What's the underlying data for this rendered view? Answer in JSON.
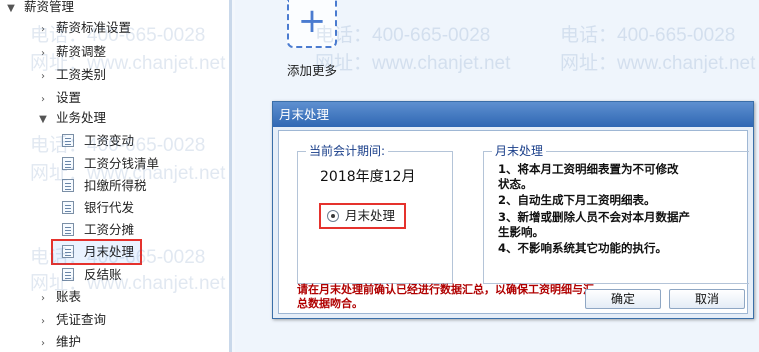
{
  "sidebar": {
    "items": [
      {
        "label": "薪资管理",
        "arrow": "▼"
      },
      {
        "label": "薪资标准设置",
        "arrow": "›"
      },
      {
        "label": "薪资调整",
        "arrow": "›"
      },
      {
        "label": "工资类别",
        "arrow": "›"
      },
      {
        "label": "设置",
        "arrow": "›"
      },
      {
        "label": "业务处理",
        "arrow": "▼"
      },
      {
        "label": "工资变动"
      },
      {
        "label": "工资分钱清单"
      },
      {
        "label": "扣缴所得税"
      },
      {
        "label": "银行代发"
      },
      {
        "label": "工资分摊"
      },
      {
        "label": "月末处理"
      },
      {
        "label": "反结账"
      },
      {
        "label": "账表",
        "arrow": "›"
      },
      {
        "label": "凭证查询",
        "arrow": "›"
      },
      {
        "label": "维护",
        "arrow": "›"
      }
    ]
  },
  "main": {
    "add_tile": {
      "plus": "+",
      "label": "添加更多"
    }
  },
  "watermark": {
    "phone": "电话：400-665-0028",
    "site": "网址：www.chanjet.net",
    "color": "#466eaa"
  },
  "dialog": {
    "title": "月末处理",
    "period_legend": "当前会计期间:",
    "period_value": "2018年度12月",
    "radio_label": "月末处理",
    "info_legend": "月末处理",
    "info_lines": [
      "1、将本月工资明细表置为不可修改",
      "状态。",
      "2、自动生成下月工资明细表。",
      "3、新增或删除人员不会对本月数据产",
      "生影响。",
      "4、不影响系统其它功能的执行。"
    ],
    "warning": "请在月末处理前确认已经进行数据汇总，以确保工资明细与汇总数据吻合。",
    "ok_label": "确定",
    "cancel_label": "取消"
  },
  "colors": {
    "highlight_border": "#e5322d",
    "dialog_title_bg": "#2f67b3",
    "warning_text": "#b00000",
    "accent_blue": "#4a7bd0"
  }
}
